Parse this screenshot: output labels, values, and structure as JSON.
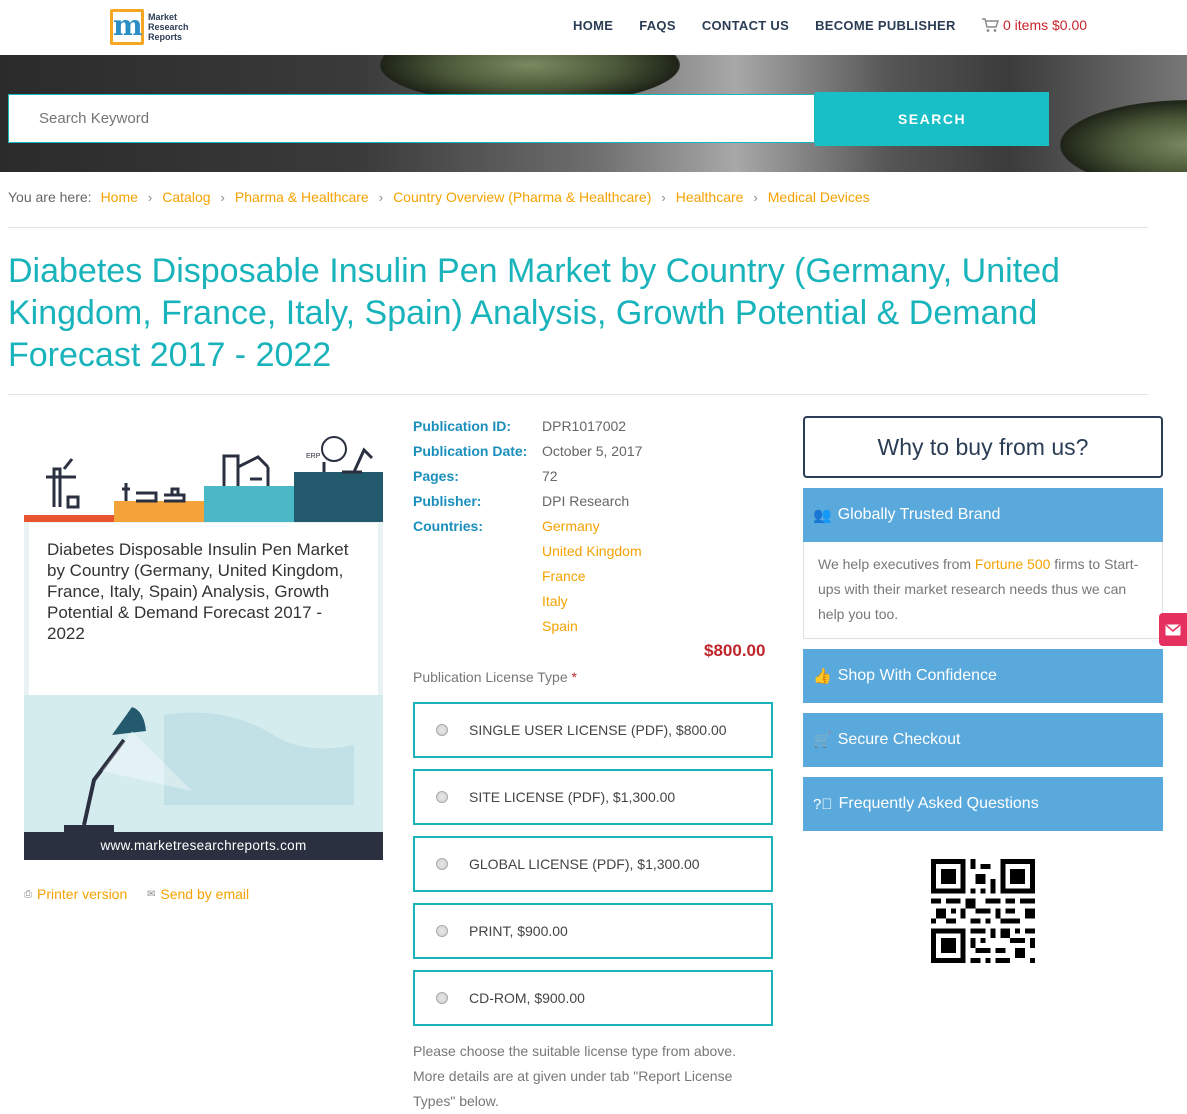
{
  "header": {
    "logo_text": [
      "Market",
      "Research",
      "Reports"
    ],
    "nav": [
      "HOME",
      "FAQS",
      "CONTACT US",
      "BECOME PUBLISHER"
    ],
    "cart": "0 items $0.00"
  },
  "search": {
    "placeholder": "Search Keyword",
    "button": "SEARCH"
  },
  "breadcrumb": {
    "prefix": "You are here:",
    "items": [
      "Home",
      "Catalog",
      "Pharma & Healthcare",
      "Country Overview (Pharma & Healthcare)",
      "Healthcare",
      "Medical Devices"
    ]
  },
  "title": "Diabetes Disposable Insulin Pen Market by Country (Germany, United Kingdom, France, Italy, Spain) Analysis, Growth Potential & Demand Forecast 2017 - 2022",
  "cover": {
    "caption": "Diabetes Disposable Insulin Pen Market by Country (Germany, United Kingdom, France, Italy, Spain) Analysis, Growth Potential & Demand Forecast 2017 - 2022",
    "url": "www.marketresearchreports.com",
    "erp_label": "ERP"
  },
  "utils": {
    "printer": "Printer version",
    "email": "Send by email"
  },
  "details": {
    "publication_id_label": "Publication ID:",
    "publication_id": "DPR1017002",
    "publication_date_label": "Publication Date:",
    "publication_date": "October 5, 2017",
    "pages_label": "Pages:",
    "pages": "72",
    "publisher_label": "Publisher:",
    "publisher": "DPI Research",
    "countries_label": "Countries:",
    "countries": [
      "Germany",
      "United Kingdom",
      "France",
      "Italy",
      "Spain"
    ]
  },
  "price": "$800.00",
  "license": {
    "label": "Publication License Type",
    "required_mark": "*",
    "options": [
      "SINGLE USER LICENSE (PDF), $800.00",
      "SITE LICENSE (PDF), $1,300.00",
      "GLOBAL LICENSE (PDF), $1,300.00",
      "PRINT, $900.00",
      "CD-ROM, $900.00"
    ],
    "note": "Please choose the suitable license type from above. More details are at given under tab \"Report License Types\" below."
  },
  "sidebar": {
    "why_title": "Why to buy from us?",
    "panels": [
      {
        "label": "Globally Trusted Brand",
        "icon": "users-icon"
      },
      {
        "label": "Shop With Confidence",
        "icon": "thumbs-up-icon"
      },
      {
        "label": "Secure Checkout",
        "icon": "cart-icon"
      },
      {
        "label": "Frequently Asked Questions",
        "icon": "question-circle-icon"
      }
    ],
    "trusted_body_pre": "We help executives from ",
    "trusted_body_highlight": "Fortune 500",
    "trusted_body_post": " firms to Start-ups with their market research needs thus we can help you too."
  },
  "colors": {
    "teal": "#19b4bb",
    "orange_link": "#f5a200",
    "blue_label": "#1a8fbd",
    "panel_blue": "#5aa9dc",
    "price_red": "#c0252b",
    "navy": "#2b3d55"
  }
}
